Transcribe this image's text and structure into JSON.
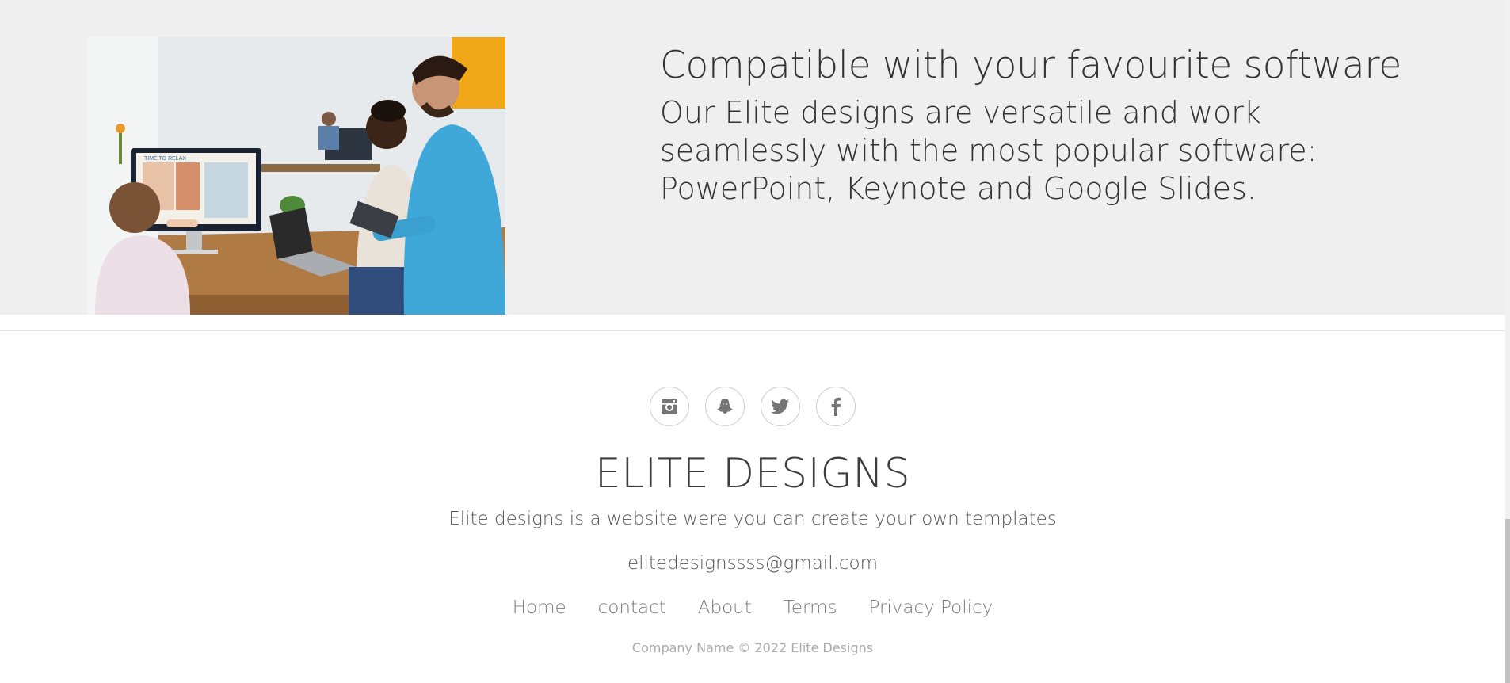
{
  "feature": {
    "title": "Compatible with your favourite software",
    "body": "Our Elite designs are versatile and work seamlessly with the most popular software: PowerPoint, Keynote and Google Slides."
  },
  "photo": {
    "screen_text": "TIME TO RELAX"
  },
  "footer": {
    "social": [
      {
        "icon": "instagram-icon"
      },
      {
        "icon": "snapchat-icon"
      },
      {
        "icon": "twitter-icon"
      },
      {
        "icon": "facebook-icon"
      }
    ],
    "brand": "ELITE DESIGNS",
    "tagline": "Elite designs is a website were you can create your own templates",
    "email": "elitedesignssss@gmail.com",
    "links": [
      "Home",
      "contact",
      "About",
      "Terms",
      "Privacy Policy"
    ],
    "copyright": "Company Name © 2022 Elite Designs"
  },
  "colors": {
    "feature_bg": "#efefef",
    "footer_bg": "#ffffff",
    "text": "#333333",
    "muted": "#aaaaaa"
  }
}
